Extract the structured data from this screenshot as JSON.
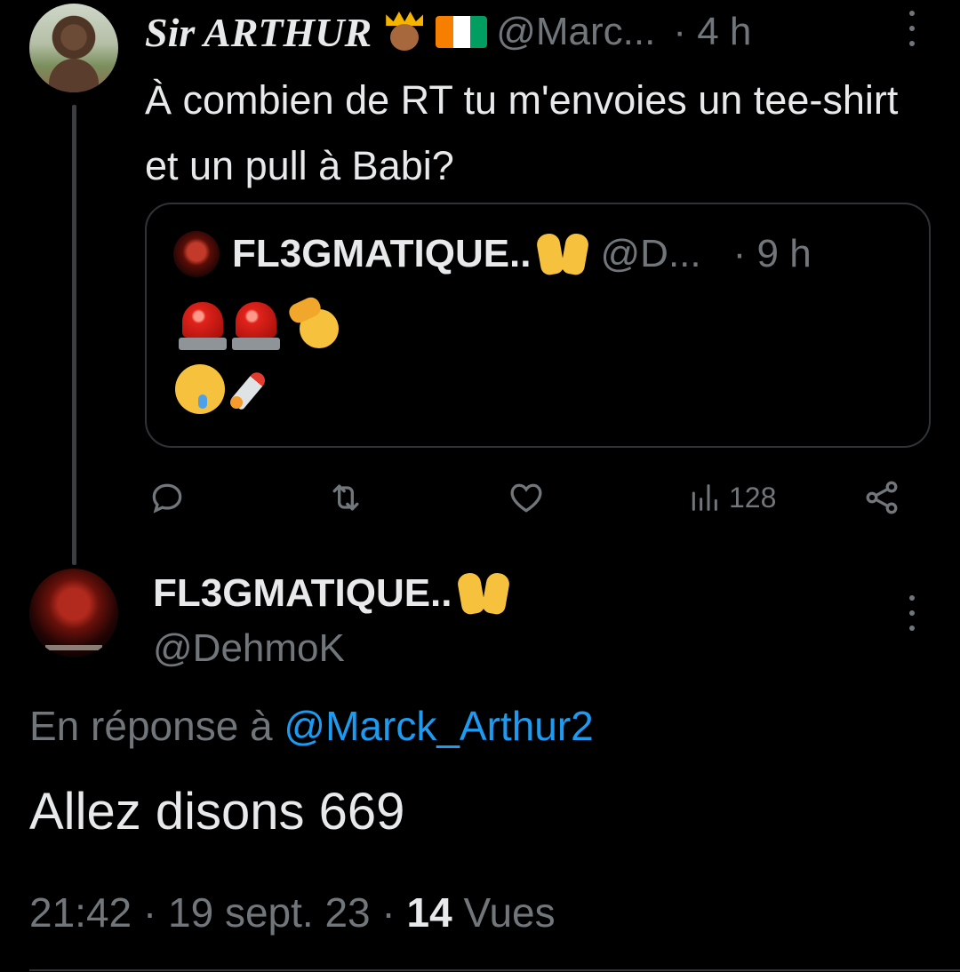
{
  "parent_tweet": {
    "display_name": "Sir ARTHUR",
    "handle": "@Marc...",
    "time": "· 4 h",
    "text": "À combien de RT tu m'envoies un tee-shirt et un pull à Babi?",
    "badges": [
      "crown-person-icon",
      "cote-divoire-flag-icon"
    ],
    "flag_colors": [
      "#f77f00",
      "#ffffff",
      "#009e60"
    ]
  },
  "quoted_tweet": {
    "display_name": "FL3GMATIQUE..",
    "handle": "@D...",
    "time": "· 9 h",
    "emojis_line1": [
      "police-siren-icon",
      "police-siren-icon",
      "saluting-face-icon"
    ],
    "emojis_line2": [
      "drooling-face-icon",
      "rocket-icon"
    ]
  },
  "actions": {
    "reply_count": "",
    "retweet_count": "",
    "like_count": "",
    "views_count": "128"
  },
  "main_tweet": {
    "display_name": "FL3GMATIQUE..",
    "handle": "@DehmoK",
    "reply_prefix": "En réponse à ",
    "reply_target": "@Marck_Arthur2",
    "text": "Allez disons 669",
    "time": "21:42",
    "date": "19 sept. 23",
    "views_value": "14",
    "views_label": "Vues"
  },
  "colors": {
    "background": "#000000",
    "text": "#e7e9ea",
    "muted": "#71767b",
    "link": "#1d9bf0",
    "border": "#2f3336"
  }
}
